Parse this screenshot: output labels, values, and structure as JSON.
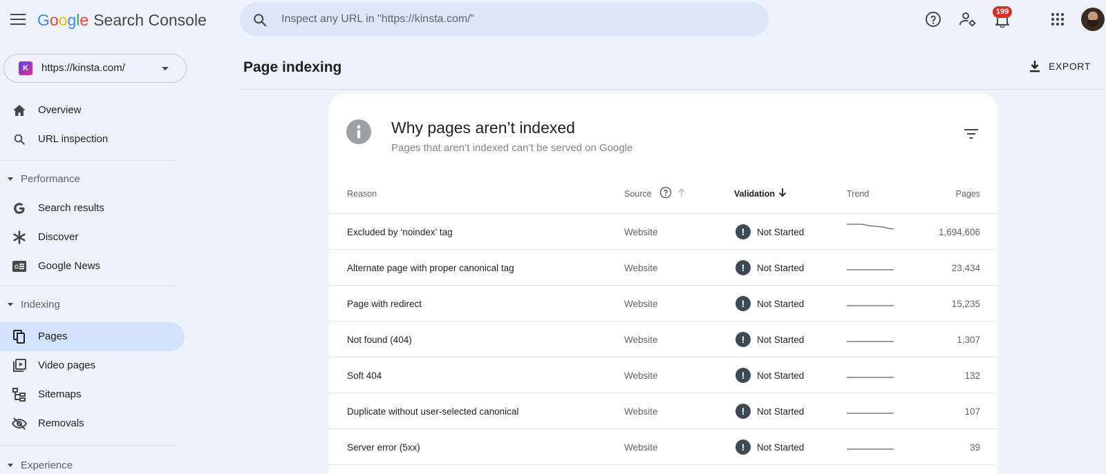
{
  "header": {
    "logo_google": [
      "G",
      "o",
      "o",
      "g",
      "l",
      "e"
    ],
    "logo_product": "Search Console",
    "search_placeholder": "Inspect any URL in \"https://kinsta.com/\"",
    "notification_count": "199"
  },
  "sidebar": {
    "property_url": "https://kinsta.com/",
    "property_badge": "K",
    "top_items": [
      {
        "label": "Overview",
        "icon": "home-icon"
      },
      {
        "label": "URL inspection",
        "icon": "search-icon"
      }
    ],
    "sections": [
      {
        "label": "Performance",
        "items": [
          {
            "label": "Search results",
            "icon": "google-g-icon"
          },
          {
            "label": "Discover",
            "icon": "asterisk-icon"
          },
          {
            "label": "Google News",
            "icon": "news-icon"
          }
        ]
      },
      {
        "label": "Indexing",
        "items": [
          {
            "label": "Pages",
            "icon": "pages-icon",
            "active": true
          },
          {
            "label": "Video pages",
            "icon": "video-pages-icon"
          },
          {
            "label": "Sitemaps",
            "icon": "sitemap-icon"
          },
          {
            "label": "Removals",
            "icon": "removals-icon"
          }
        ]
      },
      {
        "label": "Experience",
        "items": []
      }
    ]
  },
  "main": {
    "page_title": "Page indexing",
    "export_label": "EXPORT",
    "card": {
      "title": "Why pages aren’t indexed",
      "subtitle": "Pages that aren’t indexed can’t be served on Google",
      "columns": {
        "reason": "Reason",
        "source": "Source",
        "validation": "Validation",
        "trend": "Trend",
        "pages": "Pages"
      },
      "rows": [
        {
          "reason": "Excluded by ‘noindex’ tag",
          "source": "Website",
          "validation": "Not Started",
          "pages": "1,694,606"
        },
        {
          "reason": "Alternate page with proper canonical tag",
          "source": "Website",
          "validation": "Not Started",
          "pages": "23,434"
        },
        {
          "reason": "Page with redirect",
          "source": "Website",
          "validation": "Not Started",
          "pages": "15,235"
        },
        {
          "reason": "Not found (404)",
          "source": "Website",
          "validation": "Not Started",
          "pages": "1,307"
        },
        {
          "reason": "Soft 404",
          "source": "Website",
          "validation": "Not Started",
          "pages": "132"
        },
        {
          "reason": "Duplicate without user-selected canonical",
          "source": "Website",
          "validation": "Not Started",
          "pages": "107"
        },
        {
          "reason": "Server error (5xx)",
          "source": "Website",
          "validation": "Not Started",
          "pages": "39"
        }
      ]
    }
  },
  "colors": {
    "background": "#eef2fb",
    "active_nav": "#d3e3fd",
    "search_bg": "#dde6f8",
    "badge": "#d93025"
  }
}
